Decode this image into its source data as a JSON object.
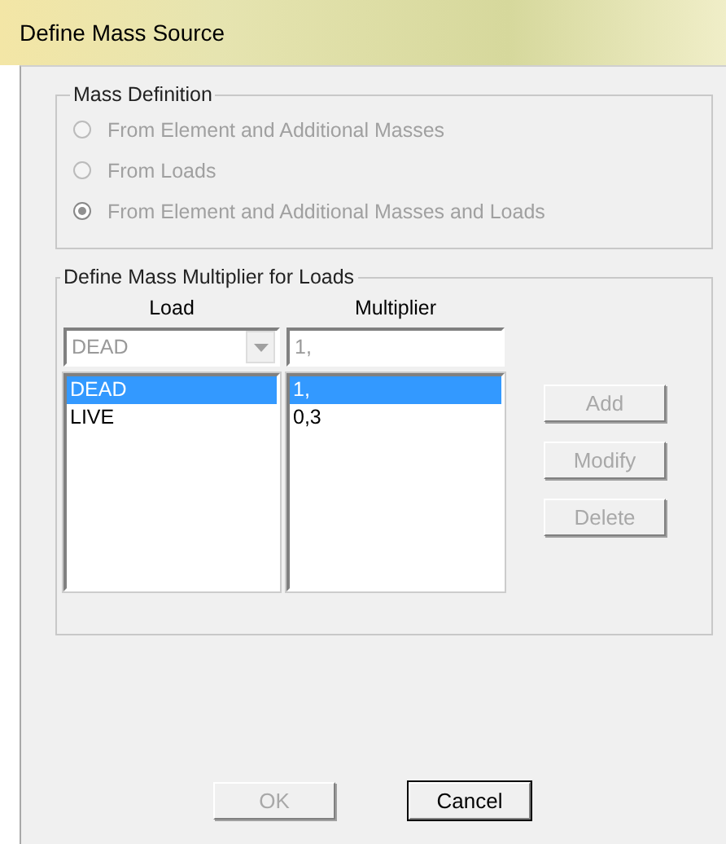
{
  "window": {
    "title": "Define Mass Source"
  },
  "mass_definition": {
    "title": "Mass Definition",
    "options": [
      {
        "label": "From Element and Additional Masses",
        "selected": false,
        "disabled": true
      },
      {
        "label": "From Loads",
        "selected": false,
        "disabled": true
      },
      {
        "label": "From Element and Additional Masses and Loads",
        "selected": true,
        "disabled": true
      }
    ]
  },
  "multipliers": {
    "title": "Define Mass Multiplier for Loads",
    "load_header": "Load",
    "multiplier_header": "Multiplier",
    "load_select": {
      "value": "DEAD",
      "disabled": true
    },
    "multiplier_field": {
      "value": "1,",
      "disabled": true
    },
    "rows": [
      {
        "load": "DEAD",
        "multiplier": "1,",
        "selected": true
      },
      {
        "load": "LIVE",
        "multiplier": "0,3",
        "selected": false
      }
    ],
    "buttons": [
      {
        "label": "Add",
        "disabled": true
      },
      {
        "label": "Modify",
        "disabled": true
      },
      {
        "label": "Delete",
        "disabled": true
      }
    ]
  },
  "footer_buttons": [
    {
      "label": "OK",
      "disabled": true
    },
    {
      "label": "Cancel",
      "disabled": false
    }
  ]
}
